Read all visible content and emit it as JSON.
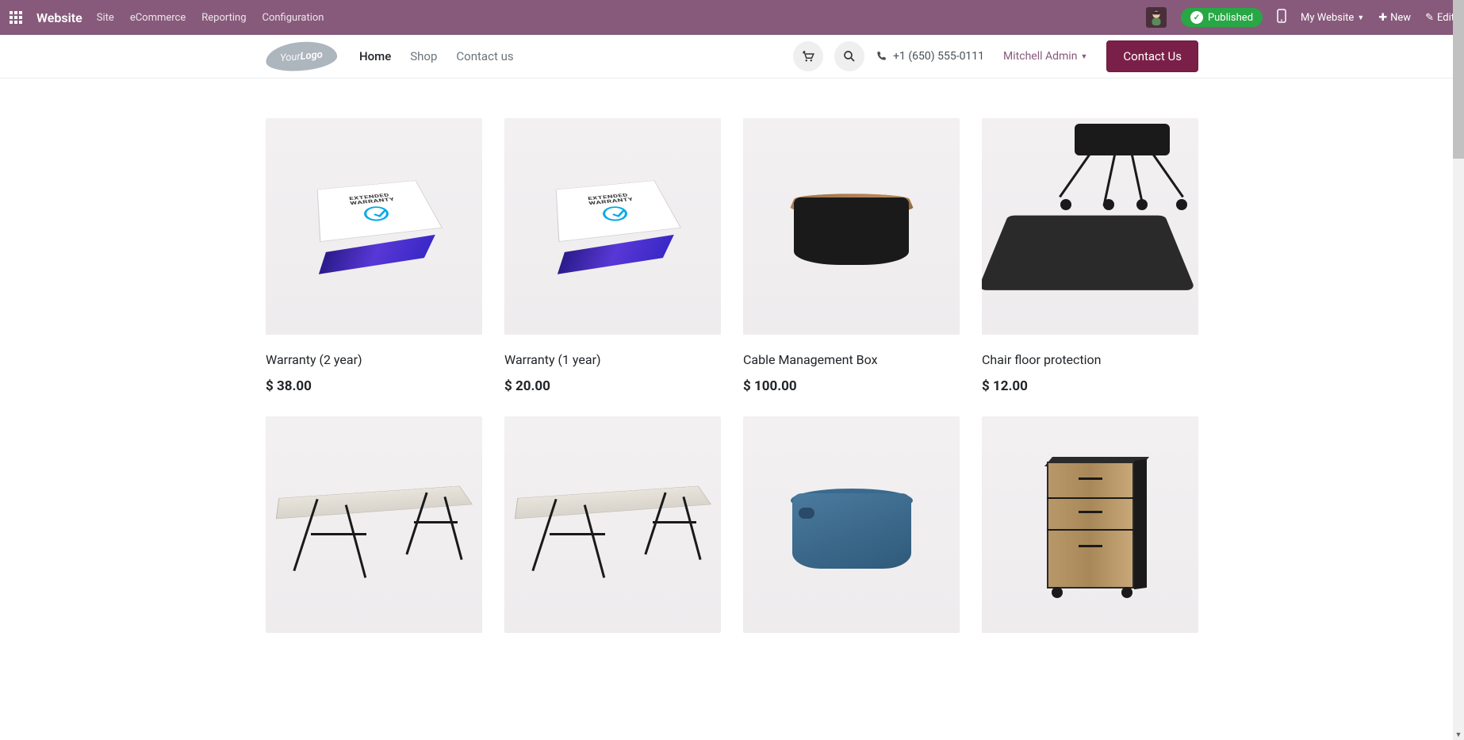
{
  "topbar": {
    "title": "Website",
    "menu": [
      "Site",
      "eCommerce",
      "Reporting",
      "Configuration"
    ],
    "published": "Published",
    "my_website": "My Website",
    "new": "New",
    "edit": "Edit"
  },
  "header": {
    "logo_your": "Your",
    "logo_logo": "Logo",
    "nav": {
      "home": "Home",
      "shop": "Shop",
      "contact": "Contact us"
    },
    "phone": "+1 (650) 555-0111",
    "user": "Mitchell Admin",
    "contact_btn": "Contact Us"
  },
  "products": [
    {
      "title": "Warranty (2 year)",
      "price": "$ 38.00",
      "img": "warranty"
    },
    {
      "title": "Warranty (1 year)",
      "price": "$ 20.00",
      "img": "warranty"
    },
    {
      "title": "Cable Management Box",
      "price": "$ 100.00",
      "img": "cable"
    },
    {
      "title": "Chair floor protection",
      "price": "$ 12.00",
      "img": "chairmat"
    },
    {
      "title": "",
      "price": "",
      "img": "desk"
    },
    {
      "title": "",
      "price": "",
      "img": "desk"
    },
    {
      "title": "",
      "price": "",
      "img": "basket"
    },
    {
      "title": "",
      "price": "",
      "img": "drawer"
    }
  ]
}
